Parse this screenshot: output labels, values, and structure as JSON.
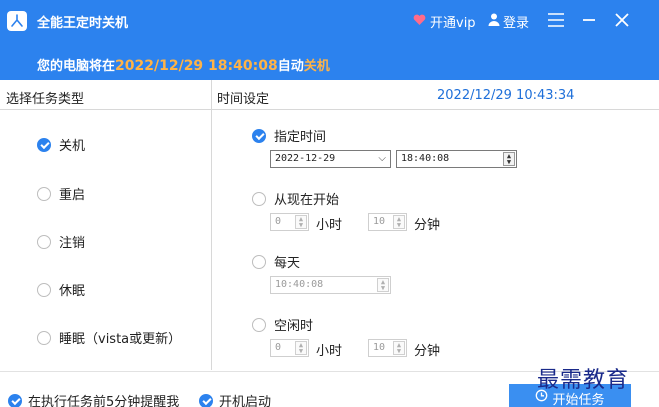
{
  "header": {
    "app_title": "全能王定时关机",
    "vip_label": "开通vip",
    "login_label": "登录",
    "status_prefix": "您的电脑将在",
    "status_time": "2022/12/29 18:40:08",
    "status_middle": "自动",
    "status_action": "关机"
  },
  "columns": {
    "task_type_label": "选择任务类型",
    "time_setting_label": "时间设定",
    "current_time": "2022/12/29 10:43:34"
  },
  "task_types": [
    {
      "label": "关机",
      "checked": true
    },
    {
      "label": "重启",
      "checked": false
    },
    {
      "label": "注销",
      "checked": false
    },
    {
      "label": "休眠",
      "checked": false
    },
    {
      "label": "睡眠（vista或更新）",
      "checked": false
    }
  ],
  "time_options": {
    "specified": {
      "label": "指定时间",
      "checked": true,
      "date": "2022-12-29",
      "time": "18:40:08"
    },
    "from_now": {
      "label": "从现在开始",
      "checked": false,
      "hours": "0",
      "hours_unit": "小时",
      "minutes": "10",
      "minutes_unit": "分钟"
    },
    "daily": {
      "label": "每天",
      "checked": false,
      "time": "10:40:08"
    },
    "idle": {
      "label": "空闲时",
      "checked": false,
      "hours": "0",
      "hours_unit": "小时",
      "minutes": "10",
      "minutes_unit": "分钟"
    }
  },
  "footer": {
    "remind_label": "在执行任务前5分钟提醒我",
    "remind_checked": true,
    "autostart_label": "开机启动",
    "autostart_checked": true,
    "start_button": "开始任务"
  },
  "watermark": "最需教育",
  "colors": {
    "brand_blue": "#2c82ee",
    "status_orange": "#ffb347",
    "heart_pink": "#ff6b8a"
  },
  "icons": [
    "app-logo-icon",
    "heart-icon",
    "user-icon",
    "menu-icon",
    "minimize-icon",
    "close-icon",
    "clock-icon"
  ]
}
